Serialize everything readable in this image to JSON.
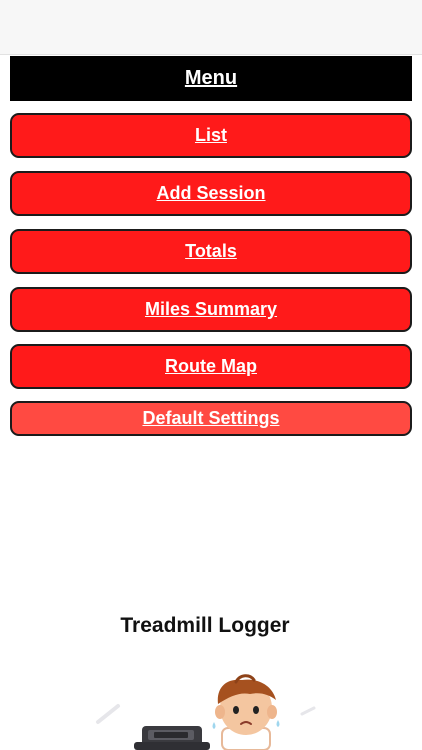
{
  "menu": {
    "title": "Menu",
    "items": [
      {
        "label": "List"
      },
      {
        "label": "Add Session"
      },
      {
        "label": "Totals"
      },
      {
        "label": "Miles Summary"
      },
      {
        "label": "Route Map"
      },
      {
        "label": "Default Settings"
      }
    ]
  },
  "app": {
    "title": "Treadmill Logger",
    "illustration_icon": "boy-on-treadmill-icon"
  },
  "colors": {
    "button_red": "#ff1a1a",
    "header_black": "#000000",
    "button_text": "#ffffff"
  }
}
